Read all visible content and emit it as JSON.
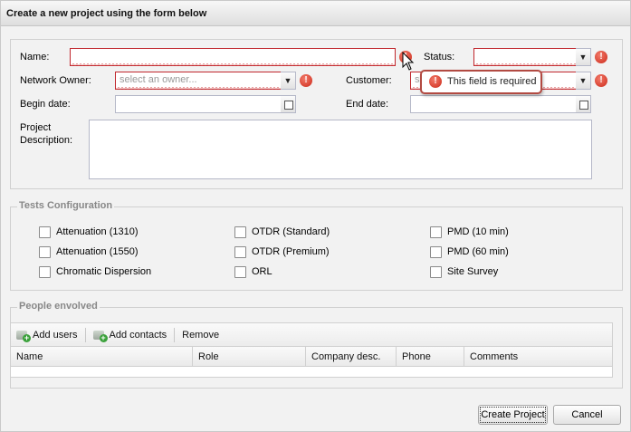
{
  "dialog": {
    "title": "Create a new project using the form below"
  },
  "form": {
    "name": {
      "label": "Name:",
      "value": ""
    },
    "status": {
      "label": "Status:",
      "value": ""
    },
    "network_owner": {
      "label": "Network Owner:",
      "placeholder": "select an owner..."
    },
    "customer": {
      "label": "Customer:",
      "value_prefix": "s"
    },
    "begin_date": {
      "label": "Begin date:",
      "value": ""
    },
    "end_date": {
      "label": "End date:",
      "value": ""
    },
    "description": {
      "label_line1": "Project",
      "label_line2": "Description:",
      "value": ""
    },
    "error_tooltip": "This field is required"
  },
  "tests": {
    "legend": "Tests Configuration",
    "items": [
      "Attenuation (1310)",
      "Attenuation (1550)",
      "Chromatic Dispersion",
      "OTDR (Standard)",
      "OTDR (Premium)",
      "ORL",
      "PMD (10 min)",
      "PMD (60 min)",
      "Site Survey"
    ]
  },
  "people": {
    "legend": "People envolved",
    "toolbar": {
      "add_users": "Add users",
      "add_contacts": "Add contacts",
      "remove": "Remove"
    },
    "columns": [
      "Name",
      "Role",
      "Company desc.",
      "Phone",
      "Comments"
    ]
  },
  "buttons": {
    "create": "Create Project",
    "cancel": "Cancel"
  },
  "colors": {
    "error": "#c0272d",
    "background": "#f2f2f2"
  }
}
